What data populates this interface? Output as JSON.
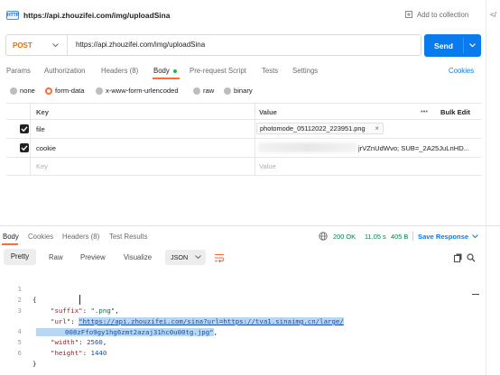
{
  "header": {
    "url_title": "https://api.zhouzifei.com/img/uploadSina",
    "add_collection": "Add to collection",
    "method_badge": "HTTP"
  },
  "request": {
    "method": "POST",
    "url": "https://api.zhouzifei.com/img/uploadSina",
    "send": "Send"
  },
  "tabs": {
    "params": "Params",
    "auth": "Authorization",
    "headers": "Headers (8)",
    "body": "Body",
    "pre": "Pre-request Script",
    "tests": "Tests",
    "settings": "Settings",
    "cookies": "Cookies"
  },
  "body_modes": [
    "none",
    "form-data",
    "x-www-form-urlencoded",
    "raw",
    "binary"
  ],
  "table": {
    "col_key": "Key",
    "col_value": "Value",
    "more": "•••",
    "bulk": "Bulk Edit",
    "rows": [
      {
        "key": "file",
        "value": "photomode_05112022_223951.png"
      },
      {
        "key": "cookie",
        "value": "jrVZnUdWvo; SUB=_2A25JuLnHD..."
      }
    ],
    "placeholder_key": "Key",
    "placeholder_value": "Value"
  },
  "response": {
    "tabs": {
      "body": "Body",
      "cookies": "Cookies",
      "headers": "Headers (8)",
      "tests": "Test Results"
    },
    "status": "200 OK",
    "time": "11.05 s",
    "size": "405 B",
    "save": "Save Response",
    "views": {
      "pretty": "Pretty",
      "raw": "Raw",
      "preview": "Preview",
      "visualize": "Visualize",
      "format": "JSON"
    }
  },
  "code": {
    "lines": [
      "1",
      "2",
      "3",
      "",
      "4",
      "5",
      "6"
    ],
    "l1": "{",
    "suffix_key": "\"suffix\"",
    "suffix_val": "\".png\"",
    "url_key": "\"url\"",
    "url_val_1": "\"https://api.zhouzifei.com/sina?url=https://tva1.sinaimg.cn/large/",
    "url_val_2": "008zFfo9gy1hg6zmt2azaj31hc0u00tg.jpg\"",
    "width_key": "\"width\"",
    "width_val": "2560",
    "height_key": "\"height\"",
    "height_val": "1440",
    "l6": "}"
  },
  "colors": {
    "accent": "#ff6c37",
    "send": "#097bed",
    "status_ok": "#0a7c4a",
    "link_blue": "#097bed"
  }
}
